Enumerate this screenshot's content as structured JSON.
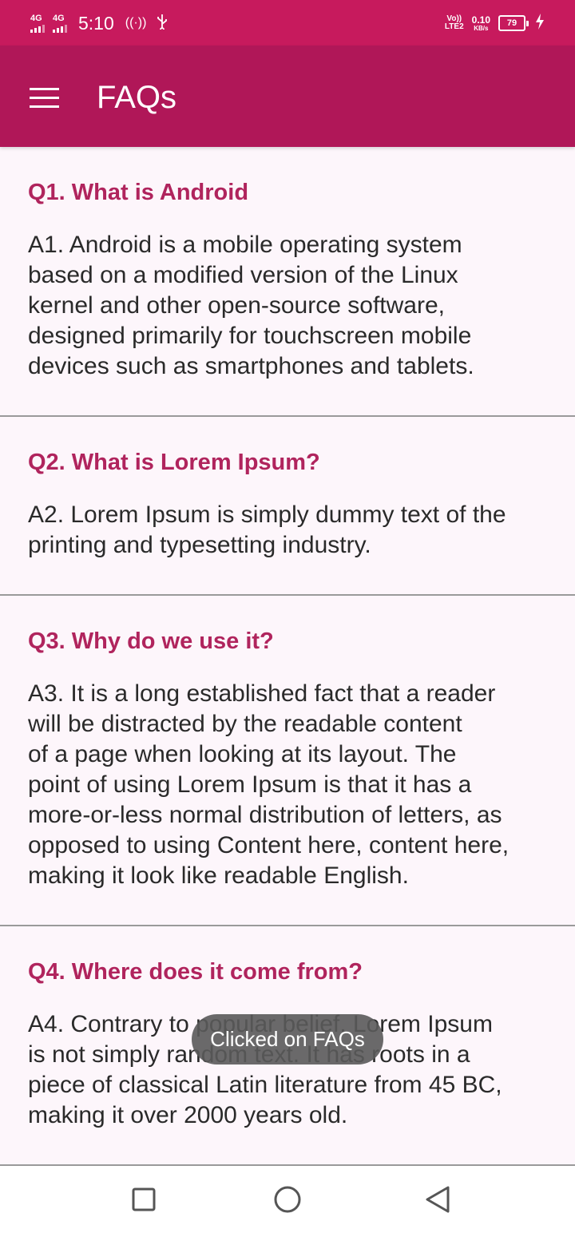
{
  "status_bar": {
    "sim1_network": "4G",
    "sim2_network": "4G",
    "time": "5:10",
    "volte_top": "Vo))",
    "volte_bottom": "LTE2",
    "net_speed_value": "0.10",
    "net_speed_unit": "KB/s",
    "battery_level": "79",
    "icons": [
      "signal-icon",
      "signal-icon",
      "hotspot-icon",
      "usb-icon",
      "battery-icon",
      "charging-icon"
    ]
  },
  "app_bar": {
    "title": "FAQs",
    "menu_icon": "hamburger-menu-icon"
  },
  "faqs": [
    {
      "question": "Q1. What is Android",
      "answer": "A1. Android is a mobile operating system\nbased on a modified version of the Linux\nkernel and other open-source software,\ndesigned primarily for touchscreen mobile\ndevices such as smartphones and tablets."
    },
    {
      "question": "Q2. What is Lorem Ipsum?",
      "answer": "A2. Lorem Ipsum is simply dummy text of the\nprinting and typesetting industry."
    },
    {
      "question": "Q3. Why do we use it?",
      "answer": "A3. It is a long established fact that a reader\nwill be distracted by the readable content\nof a page when looking at its layout. The\npoint of using Lorem Ipsum is that it has a\nmore-or-less normal distribution of letters, as\nopposed to using Content here, content here,\nmaking it look like readable English."
    },
    {
      "question": "Q4. Where does it come from?",
      "answer": "A4. Contrary to popular belief, Lorem Ipsum\nis not simply random text. It has roots in a\npiece of classical Latin literature from 45 BC,\nmaking it over 2000 years old."
    }
  ],
  "toast": {
    "text": "Clicked on FAQs"
  },
  "nav_bar": {
    "icons": [
      "recent-apps-icon",
      "home-icon",
      "back-icon"
    ]
  },
  "colors": {
    "status_bar": "#c71a5d",
    "app_bar": "#b01758",
    "question_text": "#b0245d",
    "background": "#fdf6fb"
  }
}
